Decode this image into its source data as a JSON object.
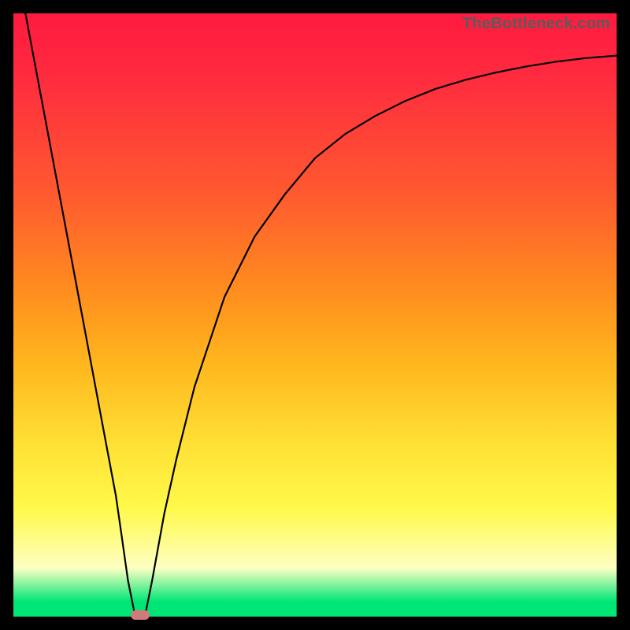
{
  "watermark": "TheBottleneck.com",
  "chart_data": {
    "type": "line",
    "title": "",
    "xlabel": "",
    "ylabel": "",
    "xlim": [
      0,
      100
    ],
    "ylim": [
      0,
      100
    ],
    "grid": false,
    "legend": false,
    "series": [
      {
        "name": "bottleneck-curve",
        "x": [
          2,
          5,
          8,
          11,
          14,
          17,
          18,
          19,
          20,
          21,
          22,
          23,
          25,
          27,
          30,
          35,
          40,
          45,
          50,
          55,
          60,
          65,
          70,
          75,
          80,
          85,
          90,
          95,
          100
        ],
        "values": [
          100,
          84,
          68,
          52,
          36,
          20,
          13,
          6,
          1,
          0.2,
          1,
          6,
          17,
          26,
          38,
          53,
          63,
          70,
          76,
          80,
          83,
          85.5,
          87.5,
          89,
          90.2,
          91.2,
          92,
          92.6,
          93
        ]
      }
    ],
    "marker": {
      "x": 21,
      "y": 0.2
    },
    "background": "gradient-red-to-green"
  }
}
